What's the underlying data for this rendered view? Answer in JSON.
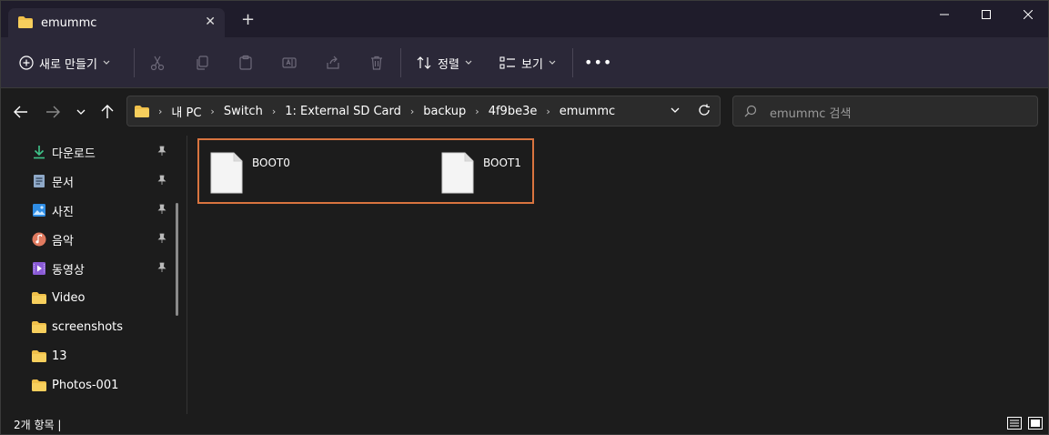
{
  "window": {
    "tab_title": "emummc",
    "new_tab": "+",
    "close_tab": "✕"
  },
  "toolbar": {
    "new_label": "새로 만들기",
    "sort_label": "정렬",
    "view_label": "보기",
    "more_label": "•••"
  },
  "address": {
    "crumbs": [
      "내 PC",
      "Switch",
      "1: External SD Card",
      "backup",
      "4f9be3e",
      "emummc"
    ],
    "search_placeholder": "emummc 검색"
  },
  "sidebar": {
    "items": [
      {
        "label": "다운로드",
        "icon": "download-icon",
        "pinned": true
      },
      {
        "label": "문서",
        "icon": "document-icon",
        "pinned": true
      },
      {
        "label": "사진",
        "icon": "pictures-icon",
        "pinned": true
      },
      {
        "label": "음악",
        "icon": "music-icon",
        "pinned": true
      },
      {
        "label": "동영상",
        "icon": "video-icon",
        "pinned": true
      },
      {
        "label": "Video",
        "icon": "folder-icon",
        "pinned": false
      },
      {
        "label": "screenshots",
        "icon": "folder-icon",
        "pinned": false
      },
      {
        "label": "13",
        "icon": "folder-icon",
        "pinned": false
      },
      {
        "label": "Photos-001",
        "icon": "folder-icon",
        "pinned": false
      }
    ]
  },
  "files": [
    {
      "name": "BOOT0",
      "icon": "file-icon"
    },
    {
      "name": "BOOT1",
      "icon": "file-icon"
    }
  ],
  "status": {
    "item_count": "2개 항목  |"
  },
  "colors": {
    "titlebar": "#1f1c2b",
    "toolbar": "#2b2838",
    "background": "#1c1c1c",
    "selection_border": "#d9743f",
    "folder": "#f0c04a"
  }
}
